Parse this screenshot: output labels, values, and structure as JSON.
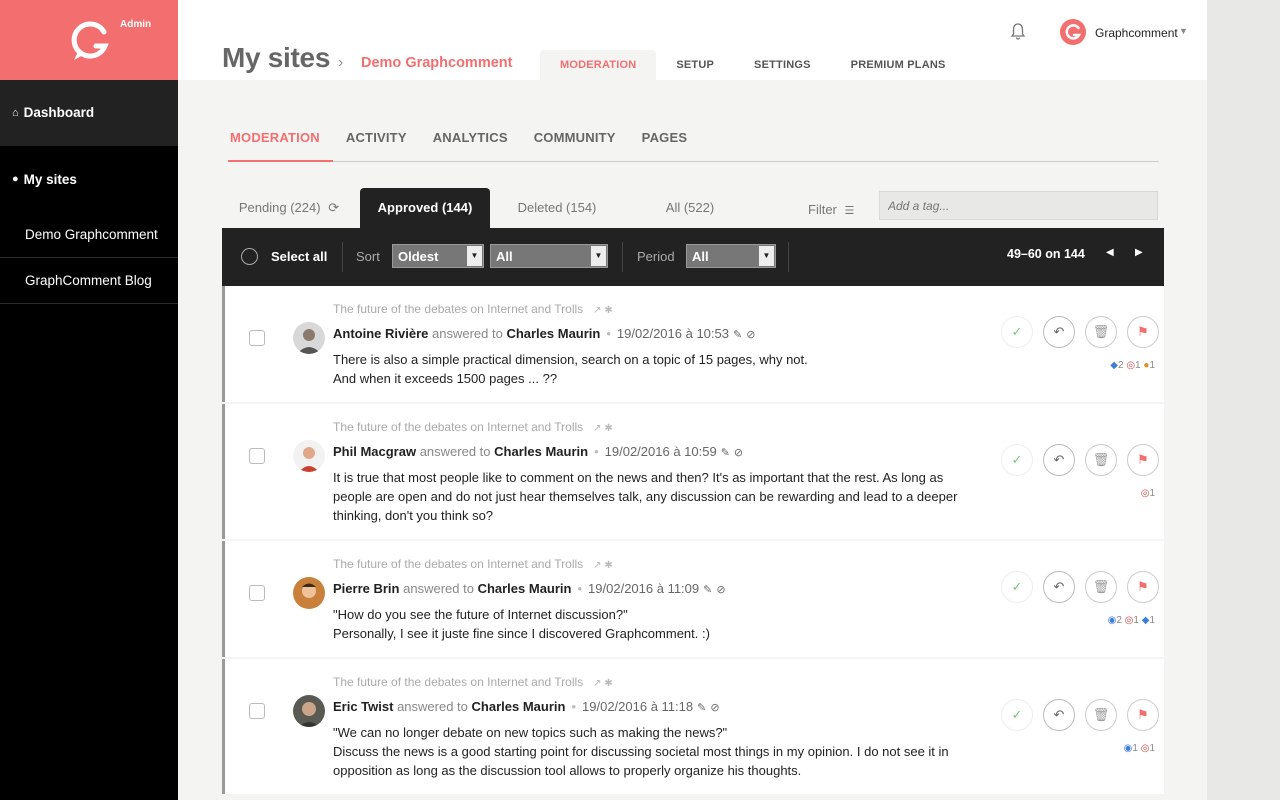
{
  "sidebar": {
    "logo_label": "Admin",
    "items": [
      {
        "label": "Dashboard",
        "icon": "home-icon"
      },
      {
        "label": "My sites",
        "icon": "globe-icon"
      },
      {
        "label": "Demo Graphcomment"
      },
      {
        "label": "GraphComment Blog"
      }
    ]
  },
  "header": {
    "title": "My sites",
    "separator": "›",
    "site": "Demo Graphcomment",
    "tabs": [
      "MODERATION",
      "SETUP",
      "SETTINGS",
      "PREMIUM PLANS"
    ],
    "user": "Graphcomment",
    "caret": "▼"
  },
  "subtabs": [
    "MODERATION",
    "ACTIVITY",
    "ANALYTICS",
    "COMMUNITY",
    "PAGES"
  ],
  "status_tabs": {
    "pending": "Pending (224)",
    "approved": "Approved (144)",
    "deleted": "Deleted (154)",
    "all": "All (522)",
    "filter": "Filter",
    "tag_placeholder": "Add a tag..."
  },
  "toolbar": {
    "select_all": "Select all",
    "sort_label": "Sort",
    "sort_value": "Oldest",
    "sort_filter": "All",
    "period_label": "Period",
    "period_value": "All",
    "pagination": "49–60 on 144"
  },
  "comments": [
    {
      "thread": "The future of the debates on Internet and Trolls",
      "author": "Antoine Rivière",
      "answered": "answered to",
      "to": "Charles Maurin",
      "date": "19/02/2016 à 10:53",
      "lines": [
        "There is also a simple practical dimension, search on a topic of 15 pages, why not.",
        "And when it exceeds 1500 pages ... ??"
      ],
      "badges": [
        "2",
        "1",
        "1"
      ]
    },
    {
      "thread": "The future of the debates on Internet and Trolls",
      "author": "Phil Macgraw",
      "answered": "answered to",
      "to": "Charles Maurin",
      "date": "19/02/2016 à 10:59",
      "lines": [
        "It is true that most people like to comment on the news and then? It's as important that the rest. As long as",
        "people are open and do not just hear themselves talk, any discussion can be rewarding and lead to a deeper",
        "thinking, don't you think so?"
      ],
      "badges": [
        "1"
      ]
    },
    {
      "thread": "The future of the debates on Internet and Trolls",
      "author": "Pierre Brin",
      "answered": "answered to",
      "to": "Charles Maurin",
      "date": "19/02/2016 à 11:09",
      "lines": [
        "\"How do you see the future of Internet discussion?\"",
        "Personally, I see it juste fine since I discovered Graphcomment. :)"
      ],
      "badges": [
        "2",
        "1",
        "1"
      ]
    },
    {
      "thread": "The future of the debates on Internet and Trolls",
      "author": "Eric Twist",
      "answered": "answered to",
      "to": "Charles Maurin",
      "date": "19/02/2016 à 11:18",
      "lines": [
        "\"We can no longer debate on new topics such as making the news?\"",
        "Discuss the news is a good starting point for discussing societal most things in my opinion. I do not see it in",
        "opposition as long as the discussion tool allows to properly organize his thoughts."
      ],
      "badges": [
        "1",
        "1"
      ]
    }
  ],
  "colors": {
    "accent": "#f36f6f",
    "sidebar": "#000000",
    "toolbar": "#222222"
  }
}
